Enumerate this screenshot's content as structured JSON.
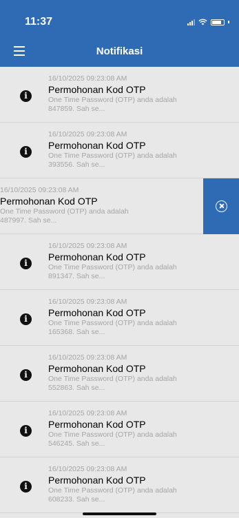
{
  "status_bar": {
    "time": "11:37"
  },
  "nav": {
    "title": "Notifikasi"
  },
  "notifications": [
    {
      "timestamp": "16/10/2025 09:23:08 AM",
      "title": "Permohonan Kod OTP",
      "message_line1": "One Time Password (OTP) anda adalah",
      "message_line2": "847859. Sah se..."
    },
    {
      "timestamp": "16/10/2025 09:23:08 AM",
      "title": "Permohonan Kod OTP",
      "message_line1": "One Time Password (OTP) anda adalah",
      "message_line2": "393556. Sah se..."
    },
    {
      "timestamp": "16/10/2025 09:23:08 AM",
      "title": "Permohonan Kod OTP",
      "message_line1": "One Time Password (OTP) anda adalah",
      "message_line2": "487997. Sah se..."
    },
    {
      "timestamp": "16/10/2025 09:23:08 AM",
      "title": "Permohonan Kod OTP",
      "message_line1": "One Time Password (OTP) anda adalah",
      "message_line2": "891347. Sah se..."
    },
    {
      "timestamp": "16/10/2025 09:23:08 AM",
      "title": "Permohonan Kod OTP",
      "message_line1": "One Time Password (OTP) anda adalah",
      "message_line2": "165368. Sah se..."
    },
    {
      "timestamp": "16/10/2025 09:23:08 AM",
      "title": "Permohonan Kod OTP",
      "message_line1": "One Time Password (OTP) anda adalah",
      "message_line2": "552863. Sah se..."
    },
    {
      "timestamp": "16/10/2025 09:23:08 AM",
      "title": "Permohonan Kod OTP",
      "message_line1": "One Time Password (OTP) anda adalah",
      "message_line2": "546245. Sah se..."
    },
    {
      "timestamp": "16/10/2025 09:23:08 AM",
      "title": "Permohonan Kod OTP",
      "message_line1": "One Time Password (OTP) anda adalah",
      "message_line2": "608233. Sah se..."
    }
  ],
  "icons": {
    "item_icon": "info-icon",
    "swipe_action_icon": "close-circle-icon"
  },
  "colors": {
    "header": "#2f6bb5",
    "background": "#e8e8e8",
    "delete_action": "#2f6bb5"
  }
}
